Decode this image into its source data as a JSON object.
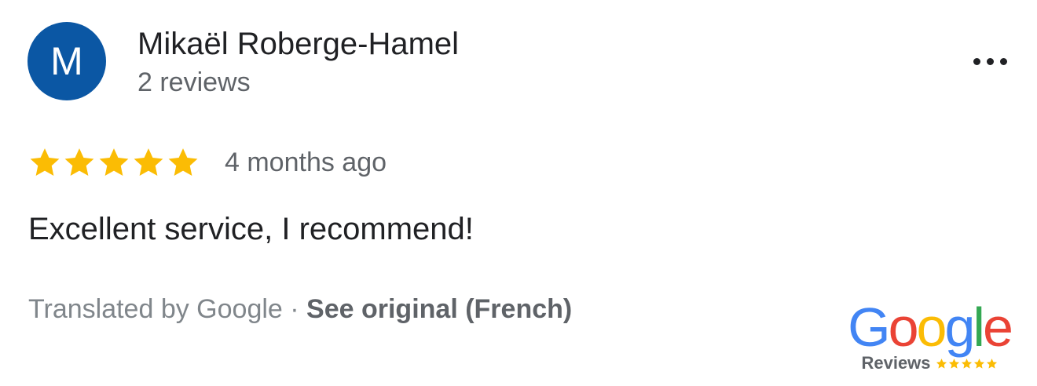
{
  "review": {
    "avatar_initial": "M",
    "reviewer_name": "Mikaël Roberge-Hamel",
    "review_count": "2 reviews",
    "rating": 5,
    "rating_max": 5,
    "date": "4 months ago",
    "text": "Excellent service, I recommend!",
    "translated_by": "Translated by Google",
    "separator": " · ",
    "see_original": "See original (French)"
  },
  "menu": {
    "icon": "more-horizontal-icon"
  },
  "badge": {
    "logo_letters": [
      "G",
      "o",
      "o",
      "g",
      "l",
      "e"
    ],
    "logo_colors": [
      "#4285F4",
      "#EA4335",
      "#FBBC05",
      "#4285F4",
      "#34A853",
      "#EA4335"
    ],
    "label": "Reviews",
    "stars": 5
  },
  "colors": {
    "avatar": "#0b57a4",
    "star": "#fbbc04",
    "primary_text": "#202124",
    "secondary_text": "#5f6368"
  }
}
